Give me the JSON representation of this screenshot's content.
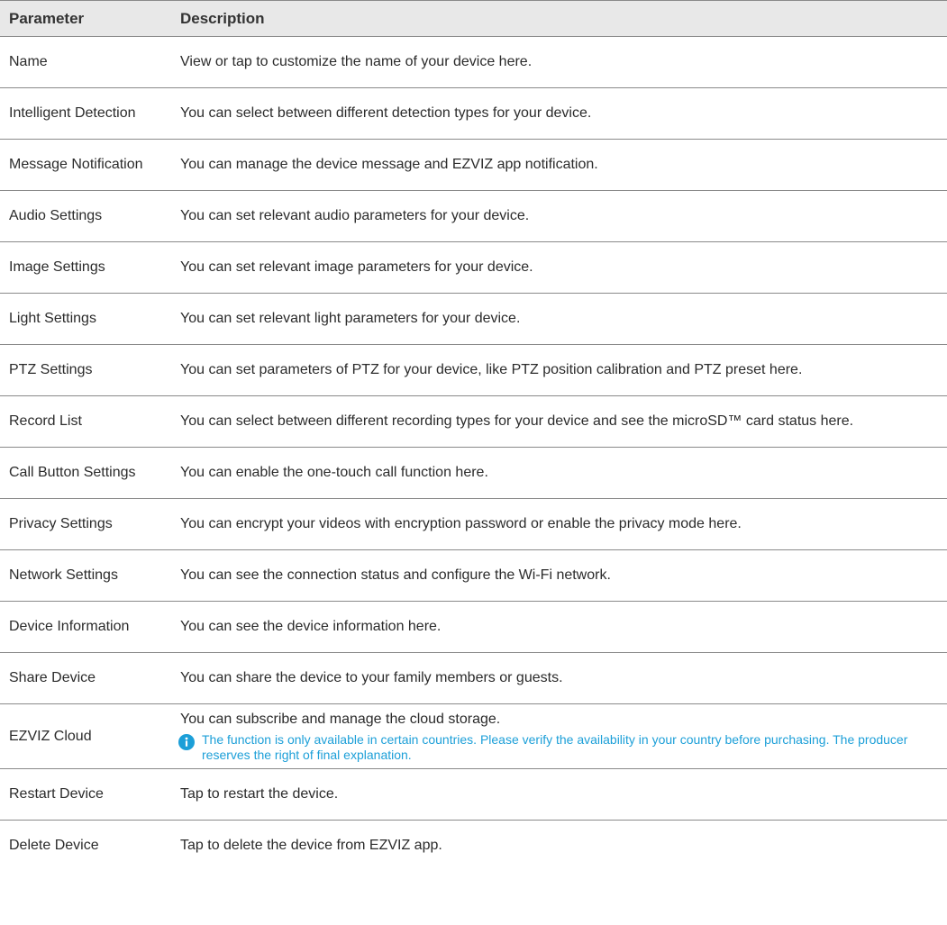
{
  "table": {
    "headers": {
      "parameter": "Parameter",
      "description": "Description"
    },
    "rows": [
      {
        "parameter": "Name",
        "description": "View or tap to customize the name of your device here."
      },
      {
        "parameter": "Intelligent Detection",
        "description": "You can select between different detection types for your device."
      },
      {
        "parameter": "Message Notification",
        "description": "You can manage the device message and EZVIZ app notification."
      },
      {
        "parameter": "Audio Settings",
        "description": "You can set relevant audio parameters for your device."
      },
      {
        "parameter": "Image Settings",
        "description": "You can set relevant image parameters for your device."
      },
      {
        "parameter": "Light Settings",
        "description": "You can set relevant light parameters for your device."
      },
      {
        "parameter": "PTZ Settings",
        "description": "You can set parameters of PTZ for your device, like PTZ position calibration and PTZ preset here."
      },
      {
        "parameter": "Record List",
        "description": "You can select between different recording types for your device and see the microSD™ card status here."
      },
      {
        "parameter": "Call Button Settings",
        "description": "You can enable the one-touch call function here."
      },
      {
        "parameter": "Privacy Settings",
        "description": "You can encrypt your videos with encryption password or enable the privacy mode here."
      },
      {
        "parameter": "Network Settings",
        "description": "You can see the connection status and configure the Wi-Fi network."
      },
      {
        "parameter": "Device Information",
        "description": "You can see the device information here."
      },
      {
        "parameter": "Share Device",
        "description": "You can share the device to your family members or guests."
      },
      {
        "parameter": "EZVIZ Cloud",
        "description": "You can subscribe and manage the cloud storage.",
        "note": "The function is only available in certain countries. Please verify the availability in your country before purchasing. The producer reserves the right of final explanation."
      },
      {
        "parameter": "Restart Device",
        "description": "Tap to restart the device."
      },
      {
        "parameter": "Delete Device",
        "description": "Tap to delete the device from EZVIZ app."
      }
    ]
  },
  "colors": {
    "header_bg": "#e8e8e8",
    "rule": "#8a8a8a",
    "note_text": "#1c9fd8",
    "info_icon": "#1c9fd8"
  },
  "icons": {
    "note": "info-icon"
  }
}
